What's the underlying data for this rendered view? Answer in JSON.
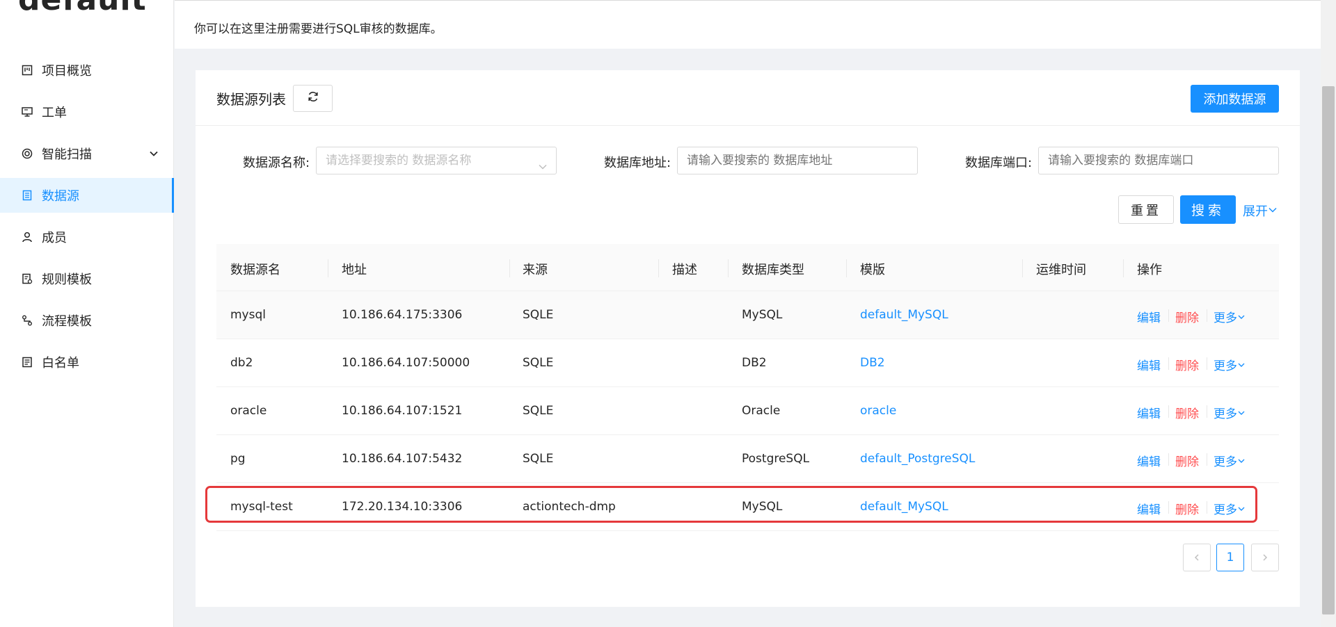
{
  "app": {
    "brand": "default",
    "description": "你可以在这里注册需要进行SQL审核的数据库。"
  },
  "sidebar": {
    "items": [
      {
        "label": "项目概览",
        "icon": "project-overview-icon"
      },
      {
        "label": "工单",
        "icon": "monitor-icon"
      },
      {
        "label": "智能扫描",
        "icon": "scan-target-icon",
        "expandable": true
      },
      {
        "label": "数据源",
        "icon": "datasource-icon",
        "active": true
      },
      {
        "label": "成员",
        "icon": "user-icon"
      },
      {
        "label": "规则模板",
        "icon": "rule-template-icon"
      },
      {
        "label": "流程模板",
        "icon": "process-template-icon"
      },
      {
        "label": "白名单",
        "icon": "whitelist-icon"
      }
    ]
  },
  "card": {
    "title": "数据源列表",
    "add_label": "添加数据源"
  },
  "filters": {
    "name_label": "数据源名称:",
    "name_placeholder": "请选择要搜索的 数据源名称",
    "address_label": "数据库地址:",
    "address_placeholder": "请输入要搜索的 数据库地址",
    "port_label": "数据库端口:",
    "port_placeholder": "请输入要搜索的 数据库端口",
    "reset_label": "重置",
    "search_label": "搜索",
    "expand_label": "展开"
  },
  "table": {
    "columns": [
      "数据源名",
      "地址",
      "来源",
      "描述",
      "数据库类型",
      "模版",
      "运维时间",
      "操作"
    ],
    "rows": [
      {
        "name": "mysql",
        "address": "10.186.64.175:3306",
        "source": "SQLE",
        "desc": "",
        "db_type": "MySQL",
        "template": "default_MySQL",
        "maint": ""
      },
      {
        "name": "db2",
        "address": "10.186.64.107:50000",
        "source": "SQLE",
        "desc": "",
        "db_type": "DB2",
        "template": "DB2",
        "maint": ""
      },
      {
        "name": "oracle",
        "address": "10.186.64.107:1521",
        "source": "SQLE",
        "desc": "",
        "db_type": "Oracle",
        "template": "oracle",
        "maint": ""
      },
      {
        "name": "pg",
        "address": "10.186.64.107:5432",
        "source": "SQLE",
        "desc": "",
        "db_type": "PostgreSQL",
        "template": "default_PostgreSQL",
        "maint": ""
      },
      {
        "name": "mysql-test",
        "address": "172.20.134.10:3306",
        "source": "actiontech-dmp",
        "desc": "",
        "db_type": "MySQL",
        "template": "default_MySQL",
        "maint": ""
      }
    ],
    "actions": {
      "edit": "编辑",
      "delete": "删除",
      "more": "更多"
    }
  },
  "pagination": {
    "current": "1"
  },
  "colors": {
    "primary": "#1890ff",
    "danger": "#ff4d4f",
    "highlight_border": "#e5393b"
  }
}
